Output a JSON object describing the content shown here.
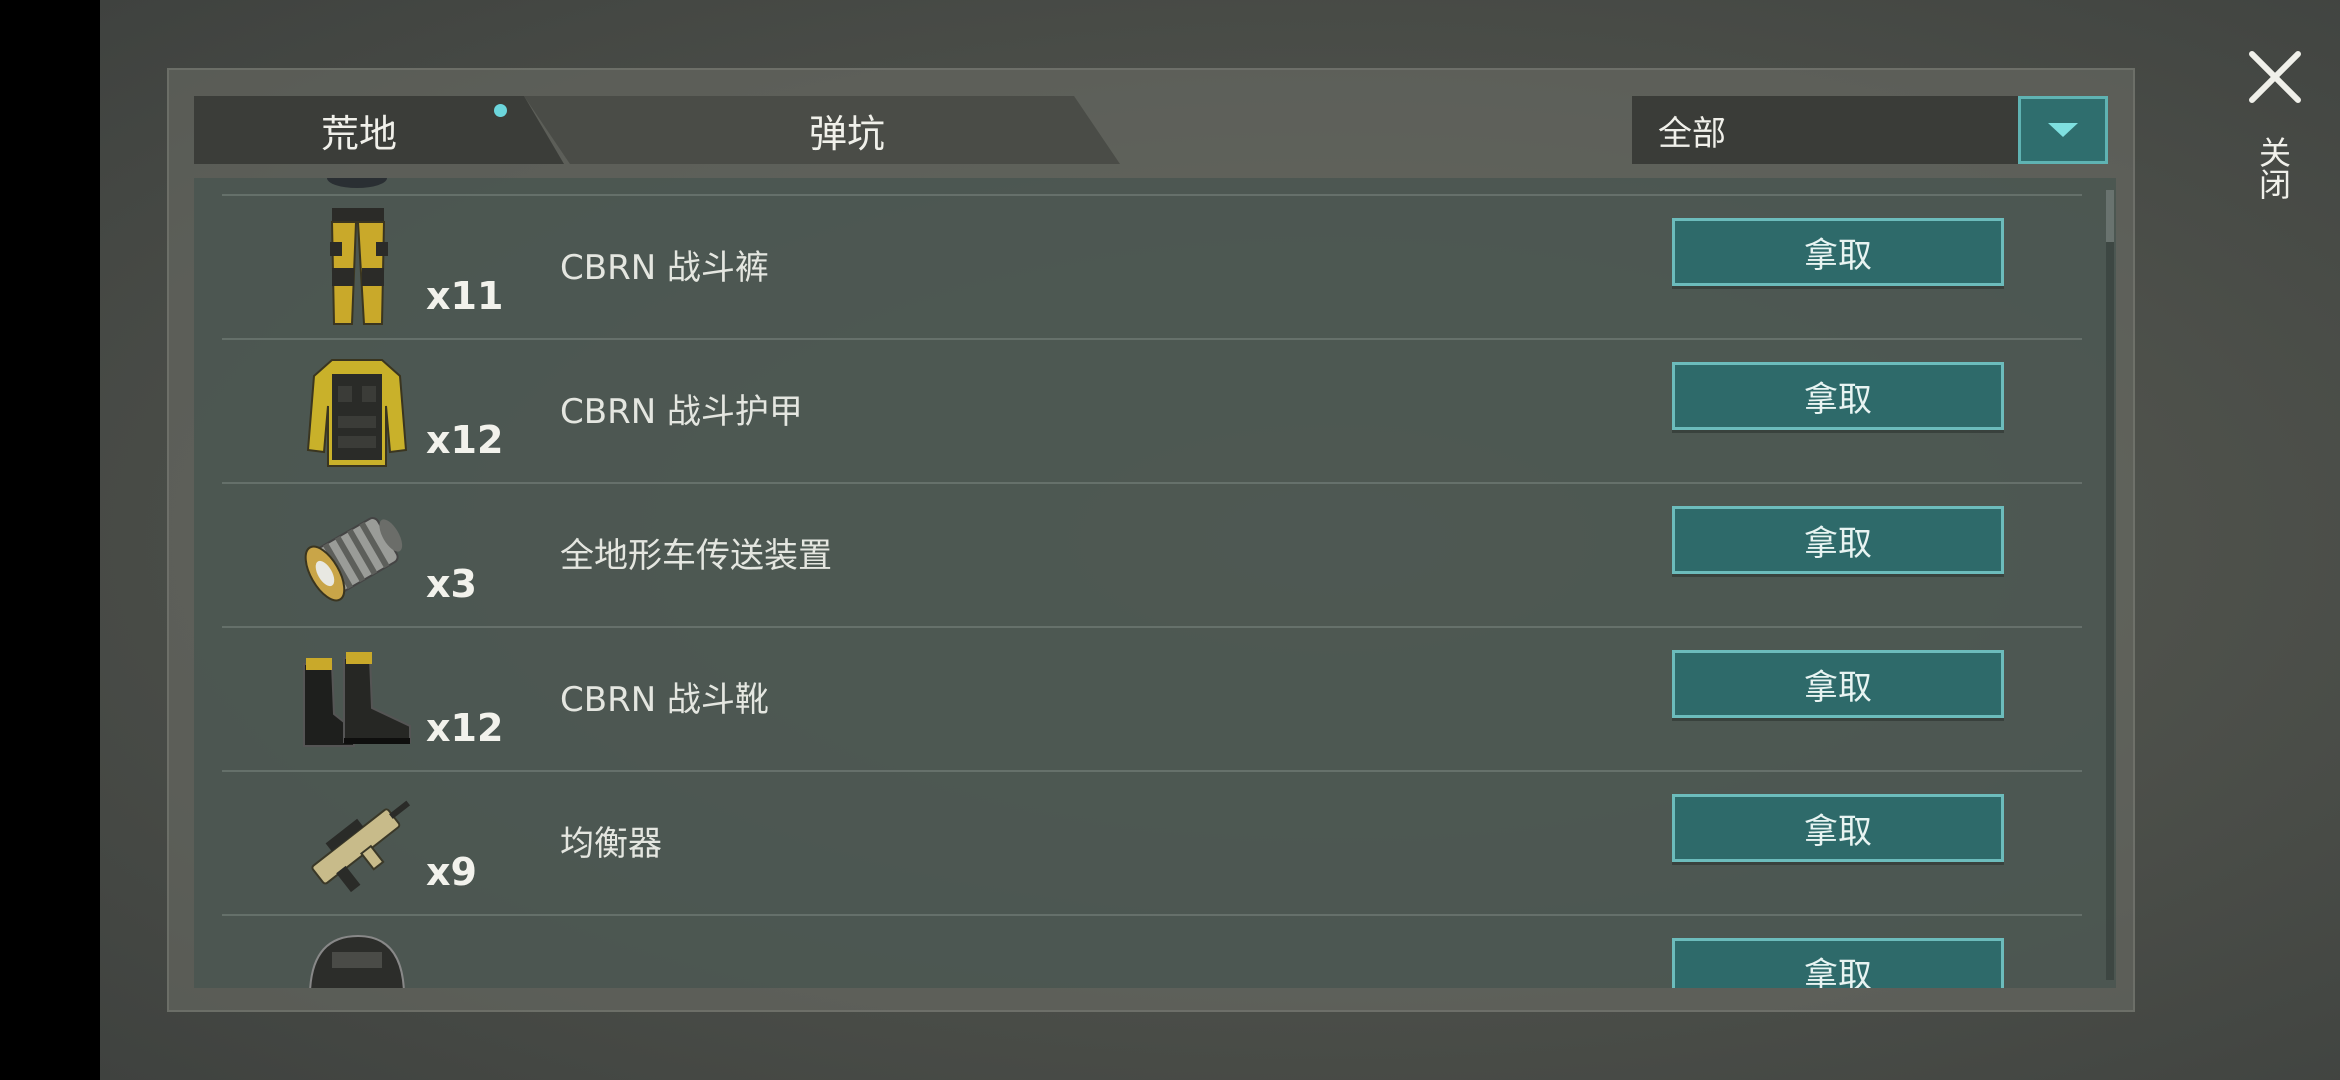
{
  "tabs": [
    {
      "label": "荒地",
      "active": true,
      "has_notification": true
    },
    {
      "label": "弹坑",
      "active": false
    }
  ],
  "filter": {
    "label": "全部"
  },
  "close": {
    "label": "关闭"
  },
  "items": [
    {
      "qty": "x11",
      "name": "CBRN 战斗裤",
      "button": "拿取",
      "icon": "yellow-pants-icon"
    },
    {
      "qty": "x12",
      "name": "CBRN 战斗护甲",
      "button": "拿取",
      "icon": "yellow-armor-vest-icon"
    },
    {
      "qty": "x3",
      "name": "全地形车传送装置",
      "button": "拿取",
      "icon": "teleport-device-icon"
    },
    {
      "qty": "x12",
      "name": "CBRN 战斗靴",
      "button": "拿取",
      "icon": "combat-boots-icon"
    },
    {
      "qty": "x9",
      "name": "均衡器",
      "button": "拿取",
      "icon": "rifle-icon"
    },
    {
      "qty": "",
      "name": "",
      "button": "拿取",
      "icon": "helmet-icon"
    }
  ],
  "colors": {
    "accent": "#2e6a6a",
    "accent_border": "#6cbcbc",
    "notification_dot": "#6cd6dc"
  }
}
